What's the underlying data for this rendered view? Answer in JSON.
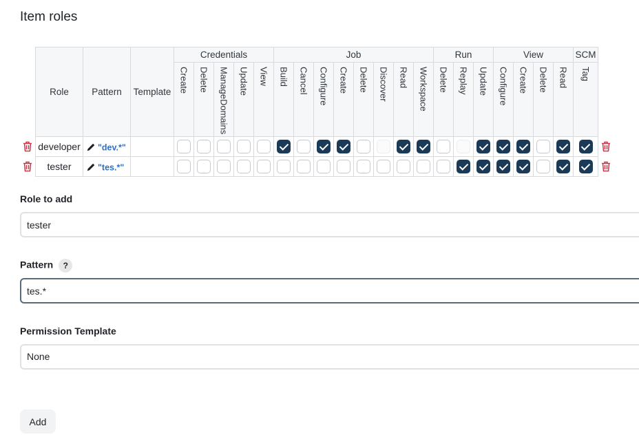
{
  "title": "Item roles",
  "table": {
    "headers": {
      "role": "Role",
      "pattern": "Pattern",
      "template": "Template"
    },
    "groups": [
      {
        "name": "Credentials",
        "span": 5
      },
      {
        "name": "Job",
        "span": 8
      },
      {
        "name": "Run",
        "span": 3
      },
      {
        "name": "View",
        "span": 4
      },
      {
        "name": "SCM",
        "span": 1
      }
    ],
    "permissions": [
      "Create",
      "Delete",
      "ManageDomains",
      "Update",
      "View",
      "Build",
      "Cancel",
      "Configure",
      "Create",
      "Delete",
      "Discover",
      "Read",
      "Workspace",
      "Delete",
      "Replay",
      "Update",
      "Configure",
      "Create",
      "Delete",
      "Read",
      "Tag"
    ],
    "rows": [
      {
        "role": "developer",
        "pattern": "\"dev.*\"",
        "template": "",
        "states": [
          0,
          0,
          0,
          0,
          0,
          1,
          0,
          1,
          1,
          0,
          2,
          1,
          1,
          0,
          2,
          1,
          1,
          1,
          0,
          1,
          1
        ]
      },
      {
        "role": "tester",
        "pattern": "\"tes.*\"",
        "template": "",
        "states": [
          0,
          0,
          0,
          0,
          0,
          0,
          0,
          0,
          0,
          0,
          0,
          0,
          0,
          0,
          1,
          1,
          1,
          1,
          0,
          1,
          1
        ]
      }
    ]
  },
  "form": {
    "role_to_add_label": "Role to add",
    "role_to_add_value": "tester",
    "pattern_label": "Pattern",
    "pattern_help": "?",
    "pattern_value": "tes.*",
    "permission_template_label": "Permission Template",
    "permission_template_value": "None",
    "add_button": "Add"
  },
  "colors": {
    "checked": "#1b3a57",
    "trash": "#c9394a",
    "link": "#2f6fc4"
  }
}
